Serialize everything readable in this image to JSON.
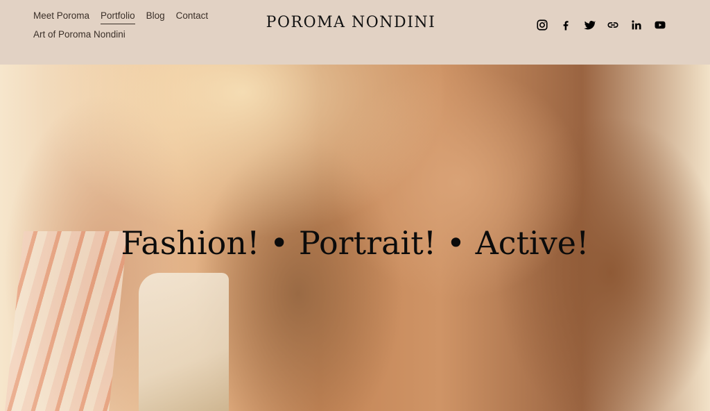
{
  "nav": {
    "items": [
      {
        "label": "Meet Poroma",
        "active": false
      },
      {
        "label": "Portfolio",
        "active": true
      },
      {
        "label": "Blog",
        "active": false
      },
      {
        "label": "Contact",
        "active": false
      },
      {
        "label": "Art of Poroma Nondini",
        "active": false
      }
    ]
  },
  "site": {
    "title": "POROMA NONDINI"
  },
  "social": [
    "instagram-icon",
    "facebook-icon",
    "twitter-icon",
    "link-icon",
    "linkedin-icon",
    "youtube-icon"
  ],
  "hero": {
    "heading": "Fashion! • Portrait! • Active!"
  },
  "colors": {
    "header_bg": "#e2d2c4",
    "text": "#3a2f28",
    "title": "#111111"
  }
}
